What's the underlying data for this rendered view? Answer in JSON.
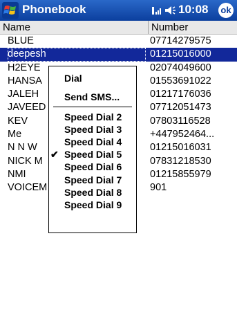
{
  "titlebar": {
    "app_title": "Phonebook",
    "clock": "10:08",
    "ok_label": "ok"
  },
  "columns": {
    "name": "Name",
    "number": "Number"
  },
  "rows": [
    {
      "name": "BLUE",
      "number": "07714279575"
    },
    {
      "name": "deepesh",
      "number": "01215016000"
    },
    {
      "name": "H2EYE",
      "number": "02074049600"
    },
    {
      "name": "HANSA",
      "number": "01553691022"
    },
    {
      "name": "JALEH",
      "number": "01217176036"
    },
    {
      "name": "JAVEED",
      "number": "07712051473"
    },
    {
      "name": "KEV",
      "number": "07803116528"
    },
    {
      "name": "Me",
      "number": "+447952464..."
    },
    {
      "name": "N N W",
      "number": "01215016031"
    },
    {
      "name": "NICK M",
      "number": "07831218530"
    },
    {
      "name": "NMI",
      "number": "01215855979"
    },
    {
      "name": "VOICEM",
      "number": "901"
    }
  ],
  "menu": {
    "dial": "Dial",
    "send_sms": "Send SMS...",
    "speed_dials": [
      "Speed Dial 2",
      "Speed Dial 3",
      "Speed Dial 4",
      "Speed Dial 5",
      "Speed Dial 6",
      "Speed Dial 7",
      "Speed Dial 8",
      "Speed Dial 9"
    ],
    "checked": "Speed Dial 5"
  },
  "colors": {
    "title_bar": "#0b3f9e",
    "selection": "#12289a"
  }
}
